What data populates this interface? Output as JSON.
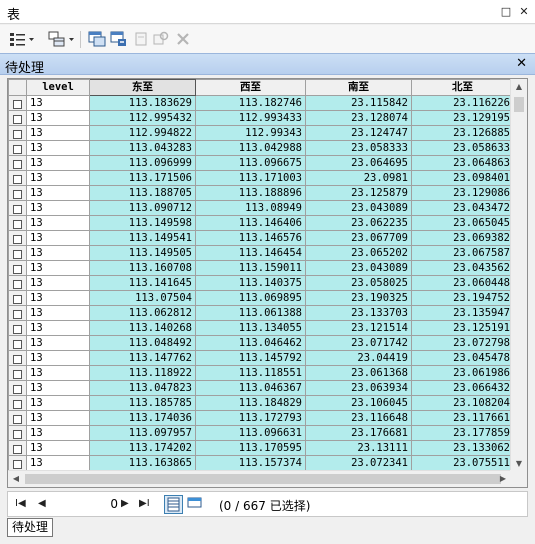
{
  "window": {
    "title": "表",
    "float_icon": "□",
    "close_icon": "✕"
  },
  "toolbar": {
    "icons": [
      "table-options-icon",
      "related-tables-icon",
      "select-by-attributes-icon",
      "switch-selection-icon",
      "clear-selection-icon",
      "zoom-to-selected-icon",
      "delete-selected-icon"
    ]
  },
  "panel": {
    "title": "待处理",
    "close_icon": "✕"
  },
  "table": {
    "columns": [
      "level",
      "东至",
      "西至",
      "南至",
      "北至"
    ],
    "rows": [
      [
        "13",
        "113.183629",
        "113.182746",
        "23.115842",
        "23.116226"
      ],
      [
        "13",
        "112.995432",
        "112.993433",
        "23.128074",
        "23.129195"
      ],
      [
        "13",
        "112.994822",
        "112.99343",
        "23.124747",
        "23.126885"
      ],
      [
        "13",
        "113.043283",
        "113.042988",
        "23.058333",
        "23.058633"
      ],
      [
        "13",
        "113.096999",
        "113.096675",
        "23.064695",
        "23.064863"
      ],
      [
        "13",
        "113.171506",
        "113.171003",
        "23.0981",
        "23.098401"
      ],
      [
        "13",
        "113.188705",
        "113.188896",
        "23.125879",
        "23.129086"
      ],
      [
        "13",
        "113.090712",
        "113.08949",
        "23.043089",
        "23.043472"
      ],
      [
        "13",
        "113.149598",
        "113.146406",
        "23.062235",
        "23.065045"
      ],
      [
        "13",
        "113.149541",
        "113.146576",
        "23.067709",
        "23.069382"
      ],
      [
        "13",
        "113.149505",
        "113.146454",
        "23.065202",
        "23.067587"
      ],
      [
        "13",
        "113.160708",
        "113.159011",
        "23.043089",
        "23.043562"
      ],
      [
        "13",
        "113.141645",
        "113.140375",
        "23.058025",
        "23.060448"
      ],
      [
        "13",
        "113.07504",
        "113.069895",
        "23.190325",
        "23.194752"
      ],
      [
        "13",
        "113.062812",
        "113.061388",
        "23.133703",
        "23.135947"
      ],
      [
        "13",
        "113.140268",
        "113.134055",
        "23.121514",
        "23.125191"
      ],
      [
        "13",
        "113.048492",
        "113.046462",
        "23.071742",
        "23.072798"
      ],
      [
        "13",
        "113.147762",
        "113.145792",
        "23.04419",
        "23.045478"
      ],
      [
        "13",
        "113.118922",
        "113.118551",
        "23.061368",
        "23.061986"
      ],
      [
        "13",
        "113.047823",
        "113.046367",
        "23.063934",
        "23.066432"
      ],
      [
        "13",
        "113.185785",
        "113.184829",
        "23.106045",
        "23.108204"
      ],
      [
        "13",
        "113.174036",
        "113.172793",
        "23.116648",
        "23.117661"
      ],
      [
        "13",
        "113.097957",
        "113.096631",
        "23.176681",
        "23.177859"
      ],
      [
        "13",
        "113.174202",
        "113.170595",
        "23.13111",
        "23.133062"
      ],
      [
        "13",
        "113.163865",
        "113.157374",
        "23.072341",
        "23.075511"
      ]
    ]
  },
  "navigation": {
    "record_value": "0",
    "status": "(0 / 667 已选择)",
    "first_icon": "I◀",
    "prev_icon": "◀",
    "next_icon": "▶",
    "last_icon": "▶I"
  },
  "bottom_tab": {
    "label": "待处理"
  },
  "colors": {
    "cell_fill": "#b3ecec",
    "panel_header": "#c3d8f2"
  }
}
